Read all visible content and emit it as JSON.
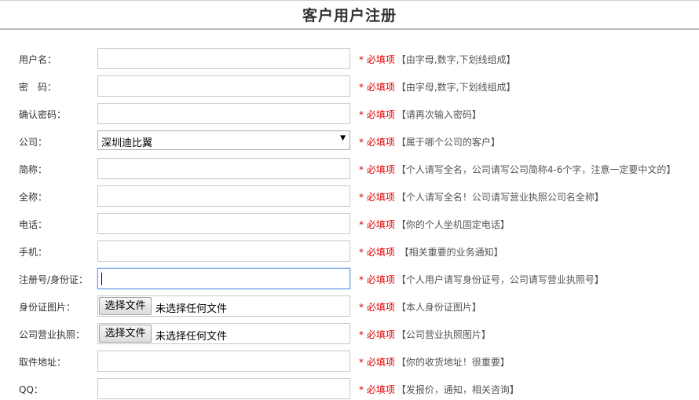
{
  "page": {
    "title": "客户用户注册"
  },
  "required_text": "* 必填项",
  "rows": [
    {
      "label": "用户名：",
      "type": "text",
      "value": "",
      "hint": "【由字母,数字,下划线组成】"
    },
    {
      "label": "密　码：",
      "type": "password",
      "value": "",
      "hint": "【由字母,数字,下划线组成】"
    },
    {
      "label": "确认密码：",
      "type": "password",
      "value": "",
      "hint": "【请再次输入密码】"
    },
    {
      "label": "公司：",
      "type": "select",
      "value": "深圳迪比翼",
      "hint": "【属于哪个公司的客户】"
    },
    {
      "label": "简称：",
      "type": "text",
      "value": "",
      "hint": "【个人请写全名，公司请写公司简称4-6个字，注意一定要中文的】"
    },
    {
      "label": "全称：",
      "type": "text",
      "value": "",
      "hint": "【个人请写全名！公司请写营业执照公司名全称】"
    },
    {
      "label": "电话：",
      "type": "text",
      "value": "",
      "hint": "【你的个人坐机固定电话】"
    },
    {
      "label": "手机：",
      "type": "text",
      "value": "",
      "hint": " 【相关重要的业务通知】"
    },
    {
      "label": "注册号/身份证：",
      "type": "text",
      "value": "",
      "focused": true,
      "hint": "【个人用户请写身份证号，公司请写营业执照号】"
    },
    {
      "label": "身份证图片：",
      "type": "file",
      "button_label": "选择文件",
      "file_status": "未选择任何文件",
      "hint": "【本人身份证图片】"
    },
    {
      "label": "公司营业执照：",
      "type": "file",
      "button_label": "选择文件",
      "file_status": "未选择任何文件",
      "hint": "【公司营业执照图片】"
    },
    {
      "label": "取件地址：",
      "type": "text",
      "value": "",
      "hint": "【你的收货地址！很重要】"
    },
    {
      "label": "QQ：",
      "type": "text",
      "value": "",
      "hint": "【发报价，通知，相关咨询】"
    }
  ],
  "colors": {
    "required": "#e00000",
    "hint": "#555555",
    "focus_border": "#6a9ee6"
  },
  "icons": {
    "select_arrow": "dropdown-triangle-icon"
  }
}
